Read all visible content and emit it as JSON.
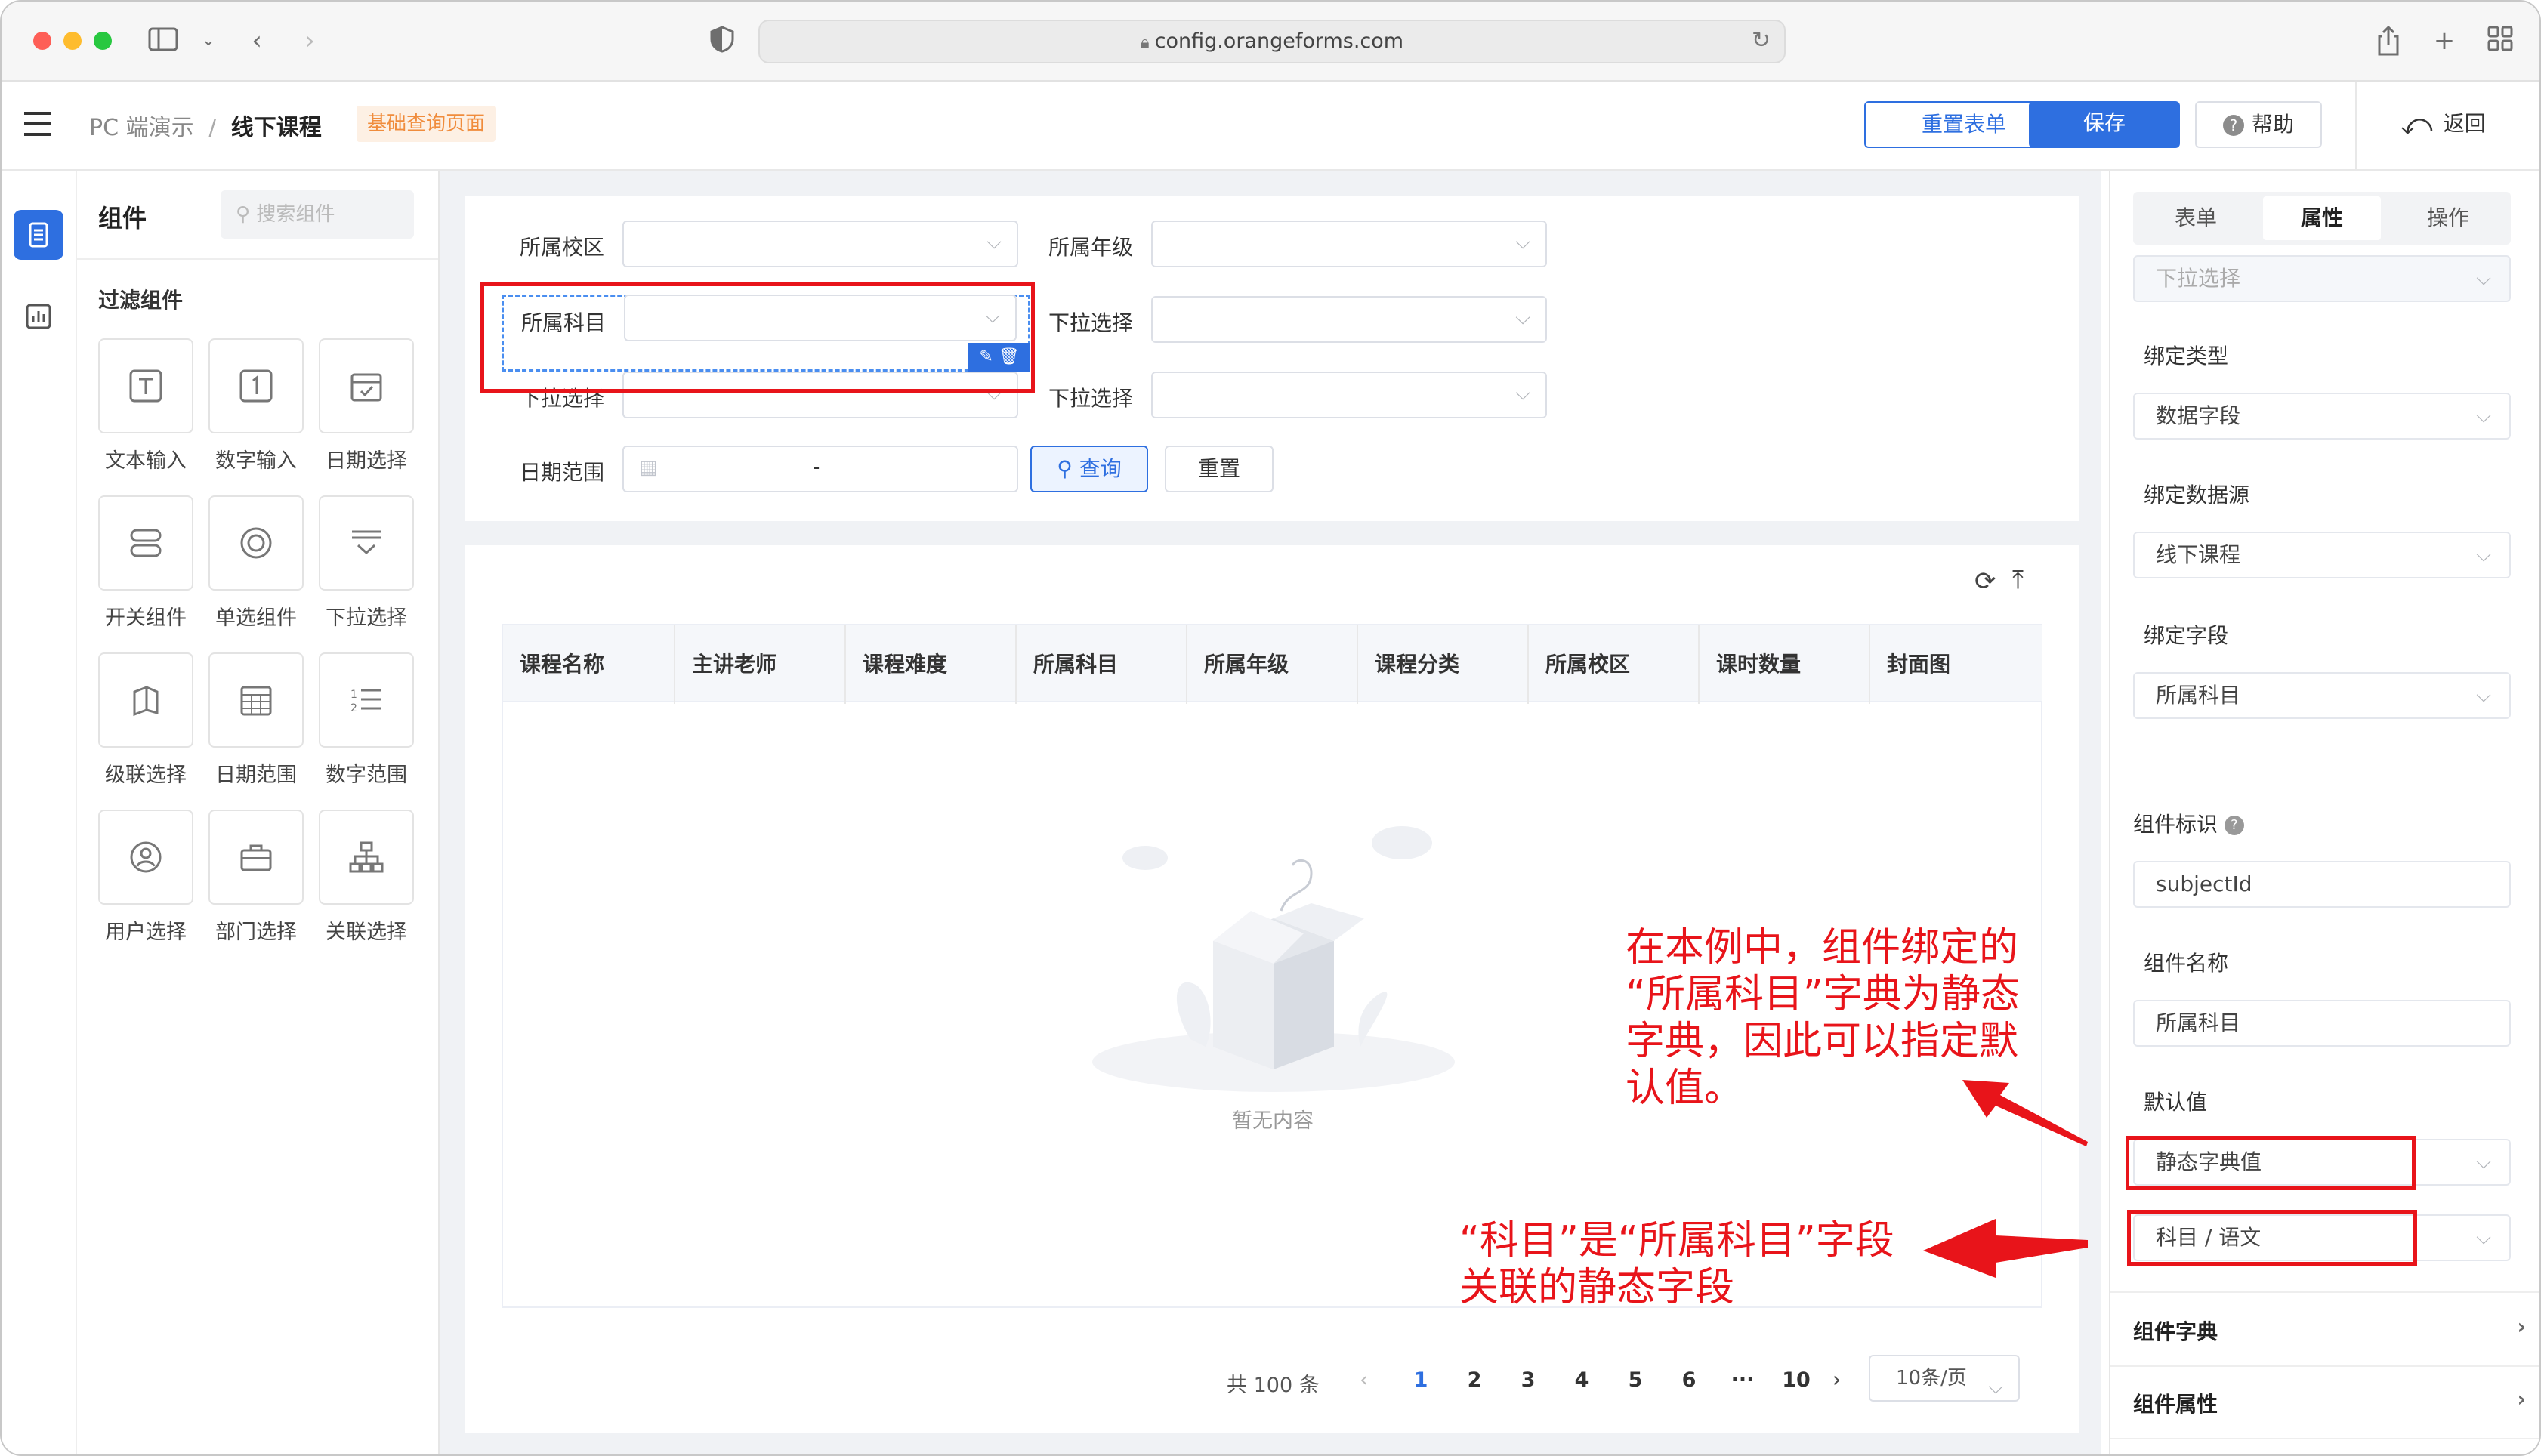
{
  "browser": {
    "url": "config.orangeforms.com"
  },
  "breadcrumb": {
    "root": "PC 端演示",
    "sep": "/",
    "current": "线下课程",
    "tag": "基础查询页面"
  },
  "header_buttons": {
    "reset": "重置表单",
    "save": "保存",
    "help": "帮助",
    "back": "返回"
  },
  "components": {
    "title": "组件",
    "search_placeholder": "搜索组件",
    "section": "过滤组件",
    "items": [
      "文本输入",
      "数字输入",
      "日期选择",
      "开关组件",
      "单选组件",
      "下拉选择",
      "级联选择",
      "日期范围",
      "数字范围",
      "用户选择",
      "部门选择",
      "关联选择"
    ]
  },
  "filter": {
    "campus": "所属校区",
    "grade": "所属年级",
    "subject": "所属科目",
    "dropdown1": "下拉选择",
    "dropdown2": "下拉选择",
    "dropdown3": "下拉选择",
    "date_range": "日期范围",
    "date_sep": "-",
    "query": "查询",
    "reset": "重置"
  },
  "table": {
    "columns": [
      "课程名称",
      "主讲老师",
      "课程难度",
      "所属科目",
      "所属年级",
      "课程分类",
      "所属校区",
      "课时数量",
      "封面图"
    ],
    "empty": "暂无内容"
  },
  "pagination": {
    "total": "共 100 条",
    "pages": [
      "1",
      "2",
      "3",
      "4",
      "5",
      "6",
      "···",
      "10"
    ],
    "current": "1",
    "size": "10条/页"
  },
  "props": {
    "tabs": [
      "表单",
      "属性",
      "操作"
    ],
    "active_tab": "属性",
    "widget_type": "下拉选择",
    "bind_type_label": "绑定类型",
    "bind_type": "数据字段",
    "bind_source_label": "绑定数据源",
    "bind_source": "线下课程",
    "bind_field_label": "绑定字段",
    "bind_field": "所属科目",
    "id_label": "组件标识",
    "id_value": "subjectId",
    "name_label": "组件名称",
    "name_value": "所属科目",
    "default_label": "默认值",
    "default_value": "静态字典值",
    "dict_value": "科目 / 语文",
    "dict_section": "组件字典",
    "prop_section": "组件属性"
  },
  "annotations": {
    "note1": [
      "在本例中，组件绑定的",
      "“所属科目”字典为静态",
      "字典，因此可以指定默",
      "认值。"
    ],
    "note2": [
      "“科目”是“所属科目”字段",
      "关联的静态字段"
    ]
  },
  "colors": {
    "primary": "#2e6fe0",
    "annotation": "#e8141a",
    "tag_bg": "#fdf0e4",
    "tag_fg": "#f08c3c"
  }
}
